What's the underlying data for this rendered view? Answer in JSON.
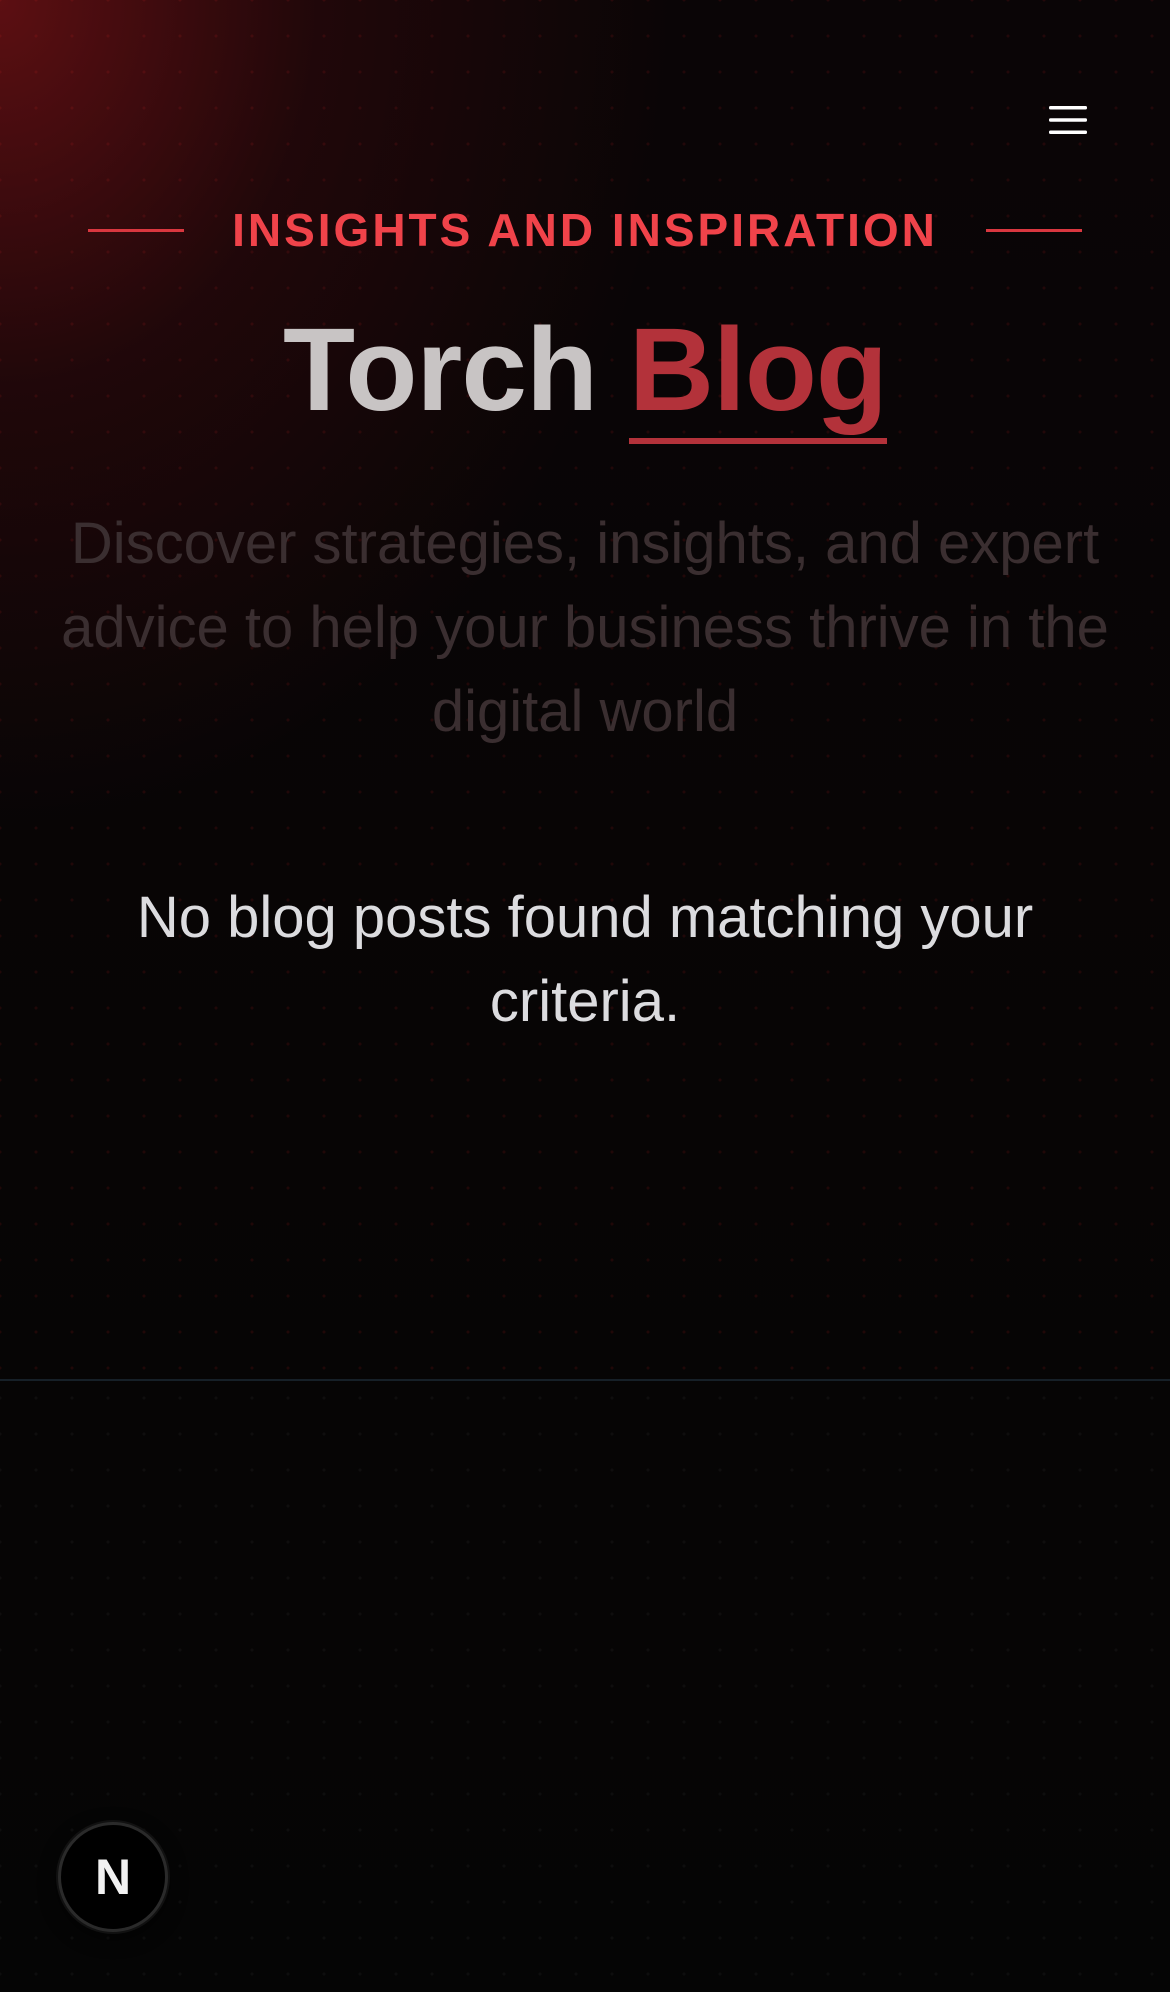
{
  "header": {
    "menu_icon": "hamburger-menu-icon"
  },
  "hero": {
    "eyebrow": "INSIGHTS AND INSPIRATION",
    "title_main": "Torch",
    "title_accent": "Blog",
    "subtitle": "Discover strategies, insights, and expert advice to help your business thrive in the digital world"
  },
  "posts": {
    "empty_message": "No blog posts found matching your criteria."
  },
  "badge": {
    "letter": "N"
  },
  "colors": {
    "accent": "#f0434a",
    "accent_dark": "#b3323a",
    "background": "#050505",
    "text": "#dcdcdf"
  }
}
